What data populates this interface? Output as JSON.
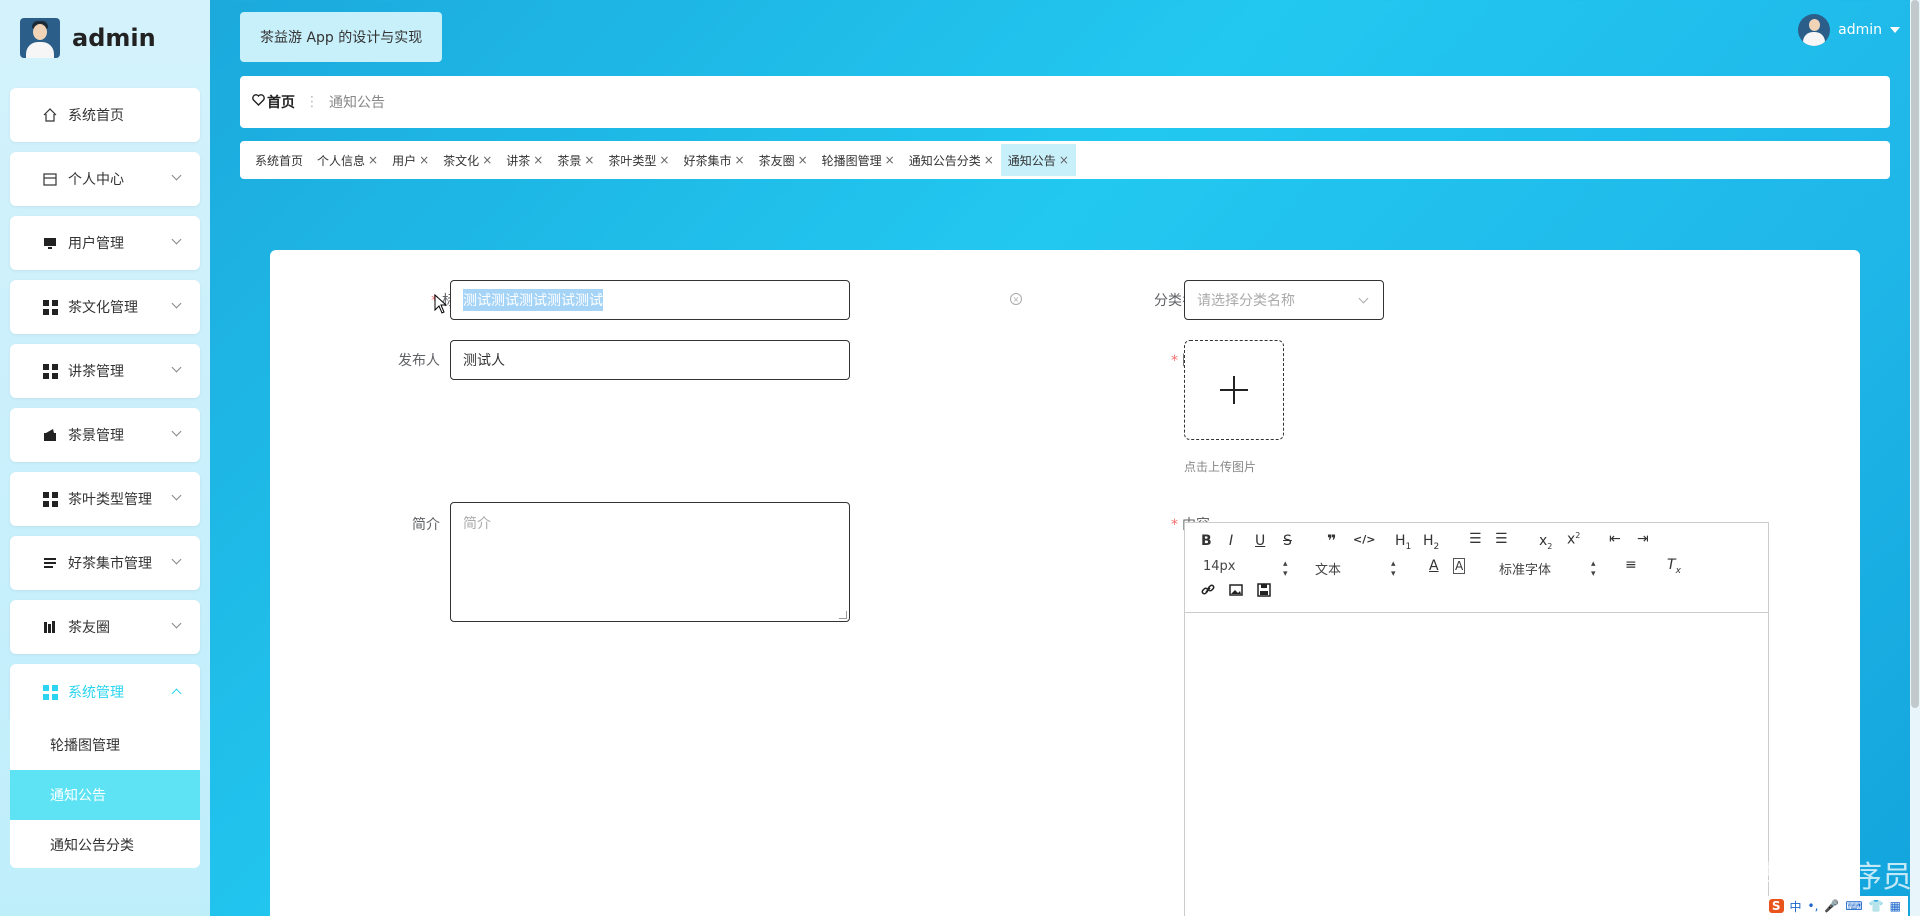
{
  "brand": {
    "name": "admin"
  },
  "sidebar": {
    "items": [
      {
        "label": "系统首页"
      },
      {
        "label": "个人中心"
      },
      {
        "label": "用户管理"
      },
      {
        "label": "茶文化管理"
      },
      {
        "label": "讲茶管理"
      },
      {
        "label": "茶景管理"
      },
      {
        "label": "茶叶类型管理"
      },
      {
        "label": "好茶集市管理"
      },
      {
        "label": "茶友圈"
      },
      {
        "label": "系统管理"
      }
    ],
    "submenu": [
      {
        "label": "轮播图管理"
      },
      {
        "label": "通知公告"
      },
      {
        "label": "通知公告分类"
      }
    ]
  },
  "header": {
    "app_title": "茶益游 App 的设计与实现",
    "user": "admin"
  },
  "breadcrumb": {
    "home": "首页",
    "current": "通知公告"
  },
  "tags": [
    {
      "label": "系统首页"
    },
    {
      "label": "个人信息"
    },
    {
      "label": "用户"
    },
    {
      "label": "茶文化"
    },
    {
      "label": "讲茶"
    },
    {
      "label": "茶景"
    },
    {
      "label": "茶叶类型"
    },
    {
      "label": "好茶集市"
    },
    {
      "label": "茶友圈"
    },
    {
      "label": "轮播图管理"
    },
    {
      "label": "通知公告分类"
    },
    {
      "label": "通知公告"
    }
  ],
  "form": {
    "title_label": "标题",
    "title_value": "测试测试测试测试测试",
    "category_label": "分类名称",
    "category_placeholder": "请选择分类名称",
    "publisher_label": "发布人",
    "publisher_value": "测试人",
    "image_label": "图片",
    "upload_hint": "点击上传图片",
    "summary_label": "简介",
    "summary_placeholder": "简介",
    "content_label": "内容"
  },
  "editor": {
    "font_size": "14px",
    "paragraph": "文本",
    "font_family": "标准字体"
  },
  "watermark": "CSDN @毕业程序员",
  "tray": {
    "ime": "中"
  }
}
